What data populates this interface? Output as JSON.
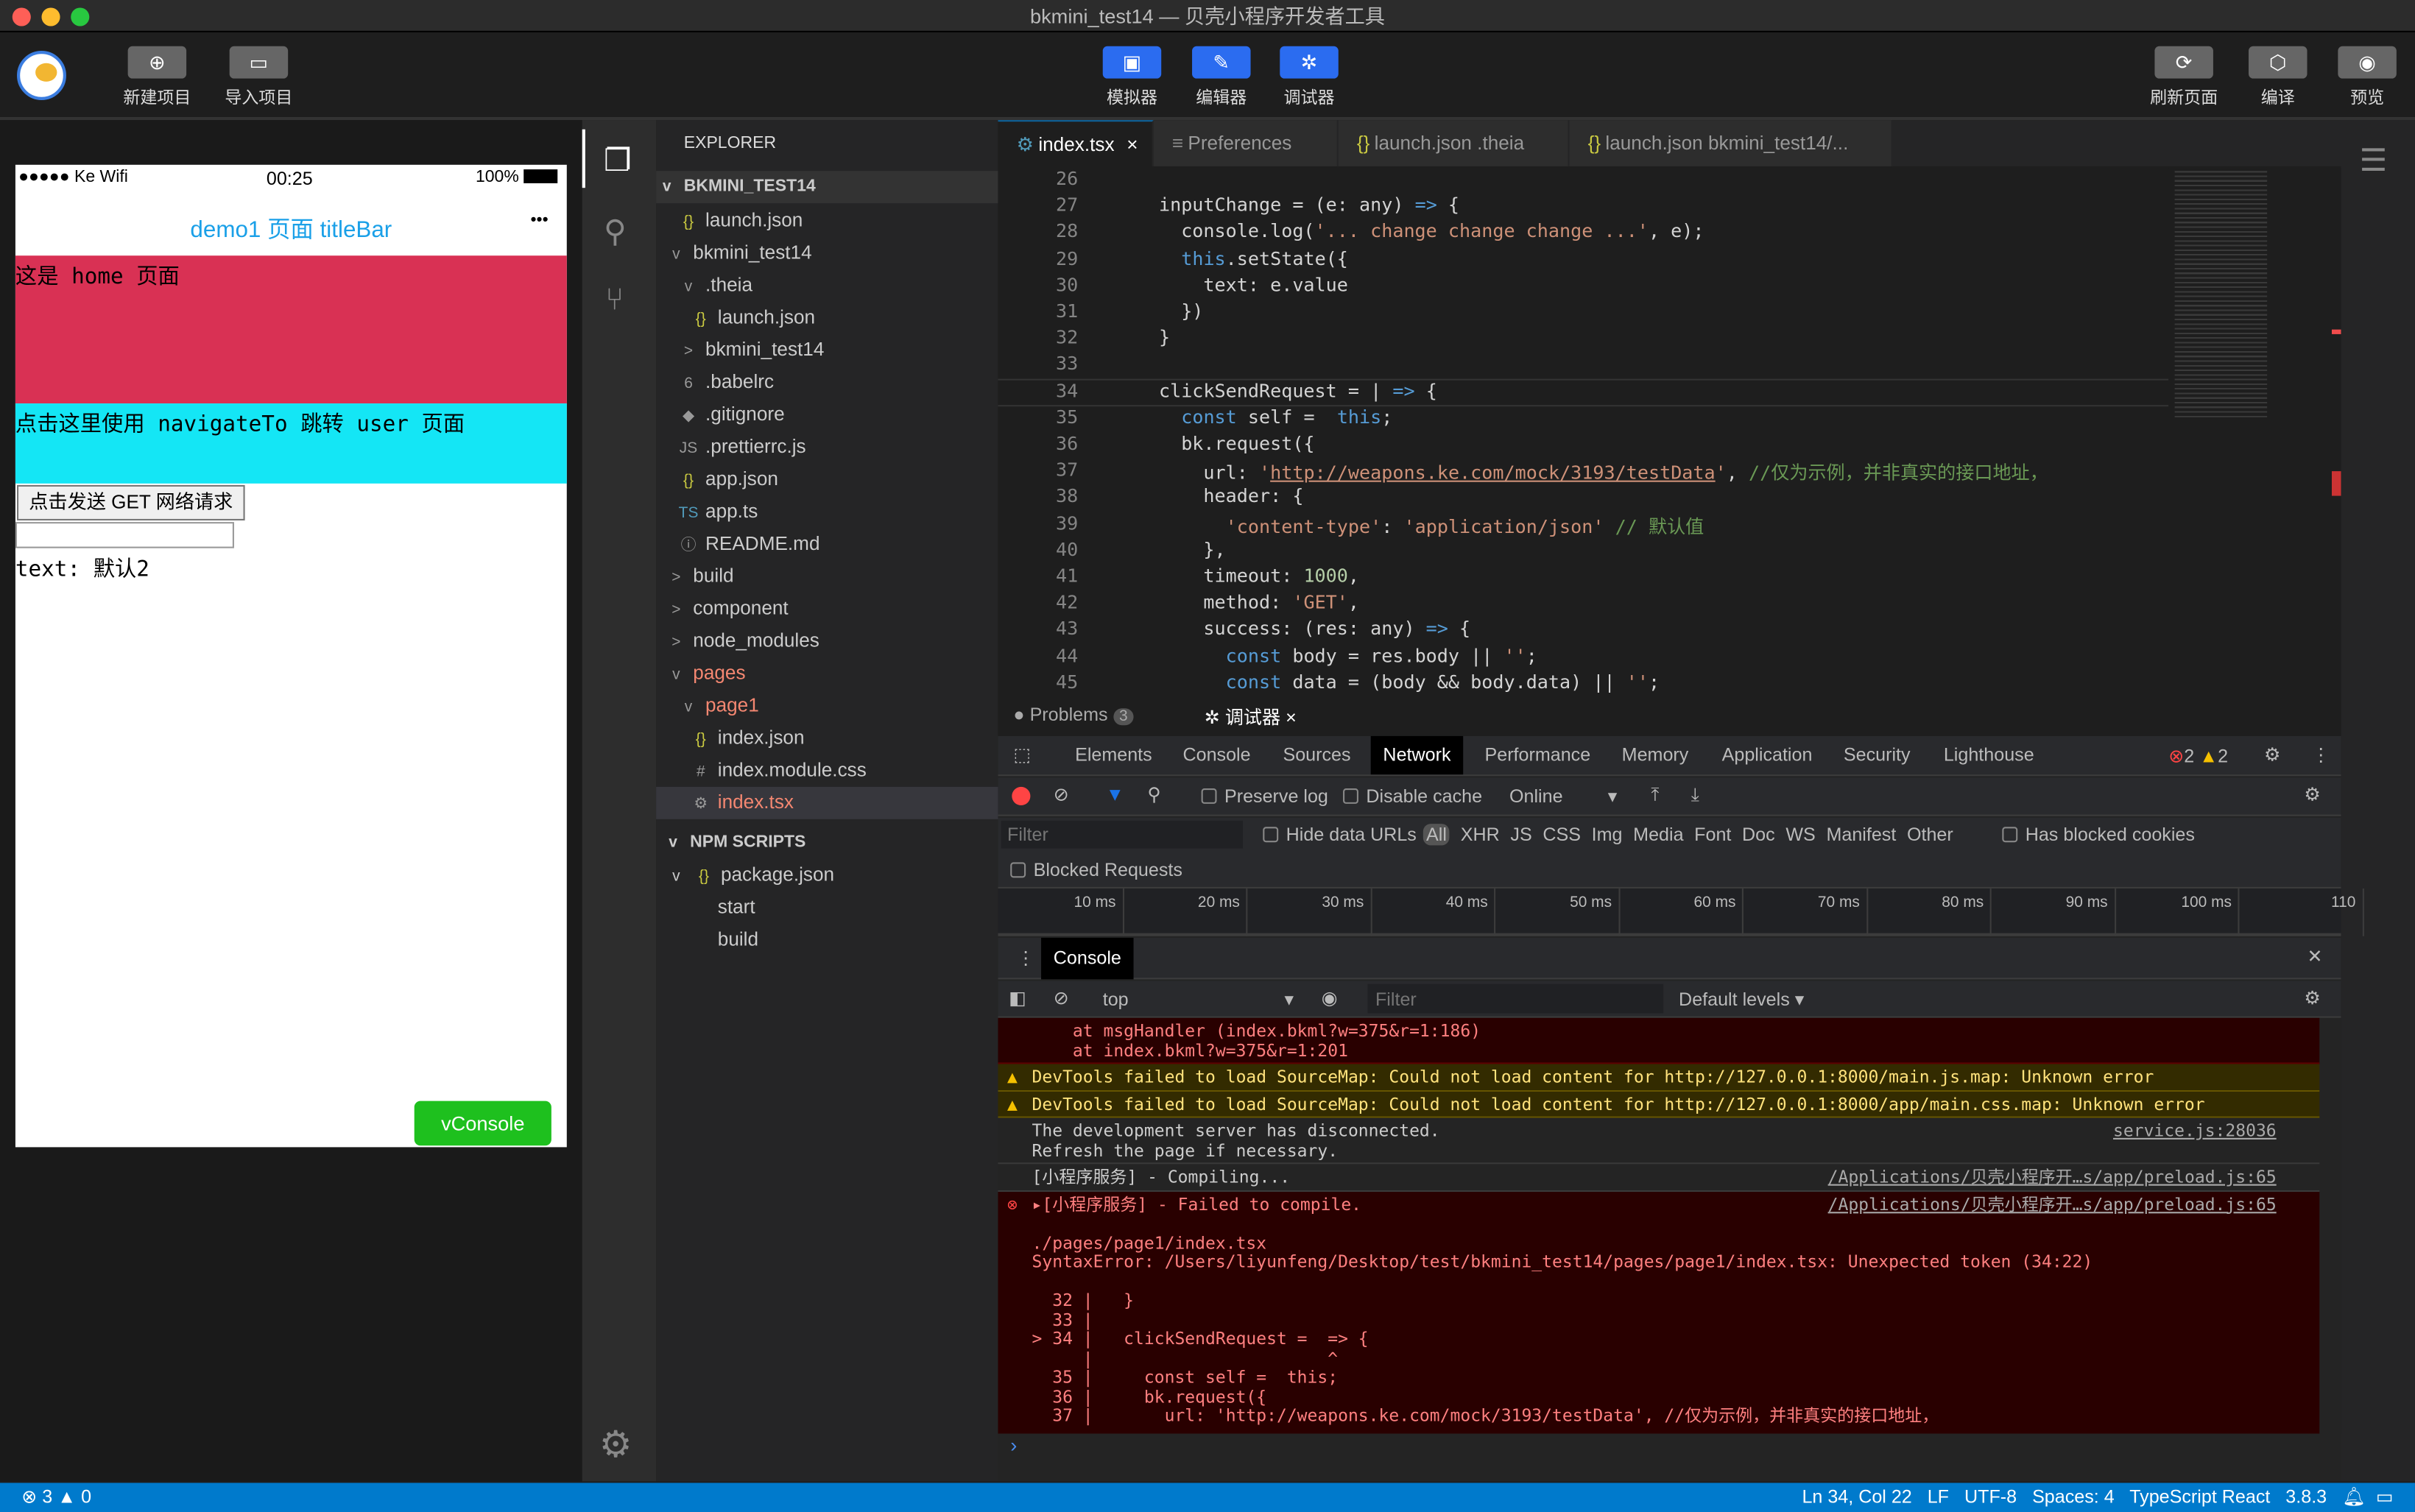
{
  "window": {
    "title": "bkmini_test14 — 贝壳小程序开发者工具"
  },
  "toolbar": {
    "left": [
      {
        "label": "新建项目",
        "icon": "plus-circle-icon"
      },
      {
        "label": "导入项目",
        "icon": "folder-icon"
      }
    ],
    "center": [
      {
        "label": "模拟器",
        "icon": "simulator-icon"
      },
      {
        "label": "编辑器",
        "icon": "editor-icon"
      },
      {
        "label": "调试器",
        "icon": "bug-icon"
      }
    ],
    "right": [
      {
        "label": "刷新页面",
        "icon": "refresh-icon"
      },
      {
        "label": "编译",
        "icon": "cube-icon"
      },
      {
        "label": "预览",
        "icon": "eye-icon"
      }
    ],
    "accent": "#2b6cf0"
  },
  "phone": {
    "carrier": "●●●●● Ke Wifi",
    "time": "00:25",
    "battery": "100%",
    "title": "demo1 页面 titleBar",
    "menu": "•••",
    "home_text": "这是 home 页面",
    "nav_text": "点击这里使用 navigateTo 跳转 user 页面",
    "button": "点击发送 GET 网络请求",
    "input_value": "",
    "text_label": "text: 默认2",
    "vconsole": "vConsole",
    "colors": {
      "home": "#d93154",
      "nav": "#14e6f5",
      "title": "#1aa0e8",
      "vconsole": "#1ec01e"
    }
  },
  "explorer": {
    "title": "EXPLORER",
    "section": "BKMINI_TEST14",
    "items": [
      {
        "label": "launch.json",
        "icon": "{}",
        "depth": 1,
        "color": "#ccc"
      },
      {
        "label": "bkmini_test14",
        "icon": "v",
        "depth": 0,
        "color": "#ccc"
      },
      {
        "label": ".theia",
        "icon": "v",
        "depth": 1,
        "color": "#ccc"
      },
      {
        "label": "launch.json",
        "icon": "{}",
        "depth": 2,
        "color": "#ccc"
      },
      {
        "label": "bkmini_test14",
        "icon": ">",
        "depth": 1,
        "color": "#ccc"
      },
      {
        "label": ".babelrc",
        "icon": "6",
        "depth": 1,
        "color": "#ccc"
      },
      {
        "label": ".gitignore",
        "icon": "◆",
        "depth": 1,
        "color": "#ccc"
      },
      {
        "label": ".prettierrc.js",
        "icon": "JS",
        "depth": 1,
        "color": "#ccc"
      },
      {
        "label": "app.json",
        "icon": "{}",
        "depth": 1,
        "color": "#ccc"
      },
      {
        "label": "app.ts",
        "icon": "TS",
        "depth": 1,
        "color": "#ccc"
      },
      {
        "label": "README.md",
        "icon": "ⓘ",
        "depth": 1,
        "color": "#ccc"
      },
      {
        "label": "build",
        "icon": ">",
        "depth": 0,
        "color": "#ccc"
      },
      {
        "label": "component",
        "icon": ">",
        "depth": 0,
        "color": "#ccc"
      },
      {
        "label": "node_modules",
        "icon": ">",
        "depth": 0,
        "color": "#ccc"
      },
      {
        "label": "pages",
        "icon": "v",
        "depth": 0,
        "color": "#f48771"
      },
      {
        "label": "page1",
        "icon": "v",
        "depth": 1,
        "color": "#f48771"
      },
      {
        "label": "index.json",
        "icon": "{}",
        "depth": 2,
        "color": "#ccc"
      },
      {
        "label": "index.module.css",
        "icon": "#",
        "depth": 2,
        "color": "#ccc"
      },
      {
        "label": "index.tsx",
        "icon": "⚙",
        "depth": 2,
        "color": "#f48771",
        "selected": true
      }
    ],
    "npm_title": "NPM SCRIPTS",
    "npm_items": [
      {
        "label": "package.json",
        "icon": "{}",
        "depth": 0
      },
      {
        "label": "start",
        "depth": 1
      },
      {
        "label": "build",
        "depth": 1
      }
    ]
  },
  "editor": {
    "tabs": [
      {
        "label": "index.tsx",
        "active": true,
        "close": "×"
      },
      {
        "label": "Preferences"
      },
      {
        "label": "launch.json .theia"
      },
      {
        "label": "launch.json bkmini_test14/..."
      }
    ],
    "lines": [
      {
        "n": "26",
        "seg": []
      },
      {
        "n": "27",
        "seg": [
          [
            "  inputChange = (e: any) ",
            ""
          ],
          [
            "=>",
            "kw"
          ],
          [
            " {",
            ""
          ]
        ]
      },
      {
        "n": "28",
        "seg": [
          [
            "    console.log(",
            ""
          ],
          [
            "'... change change change ...'",
            "str"
          ],
          [
            ", e);",
            ""
          ]
        ]
      },
      {
        "n": "29",
        "seg": [
          [
            "    ",
            ""
          ],
          [
            "this",
            "kw"
          ],
          [
            ".setState({",
            ""
          ]
        ]
      },
      {
        "n": "30",
        "seg": [
          [
            "      text: e.value",
            ""
          ]
        ]
      },
      {
        "n": "31",
        "seg": [
          [
            "    })",
            ""
          ]
        ]
      },
      {
        "n": "32",
        "seg": [
          [
            "  }",
            ""
          ]
        ]
      },
      {
        "n": "33",
        "seg": []
      },
      {
        "n": "34",
        "seg": [
          [
            "  clickSendRequest = | ",
            ""
          ],
          [
            "=>",
            "kw"
          ],
          [
            " {",
            ""
          ]
        ]
      },
      {
        "n": "35",
        "seg": [
          [
            "    ",
            ""
          ],
          [
            "const",
            "kw"
          ],
          [
            " self =  ",
            ""
          ],
          [
            "this",
            "kw"
          ],
          [
            ";",
            ""
          ]
        ]
      },
      {
        "n": "36",
        "seg": [
          [
            "    bk.request({",
            ""
          ]
        ]
      },
      {
        "n": "37",
        "seg": [
          [
            "      url: ",
            ""
          ],
          [
            "'",
            "str"
          ],
          [
            "http://weapons.ke.com/mock/3193/testData",
            "url"
          ],
          [
            "'",
            "str"
          ],
          [
            ", ",
            ""
          ],
          [
            "//仅为示例，并非真实的接口地址，",
            "cmt"
          ]
        ]
      },
      {
        "n": "38",
        "seg": [
          [
            "      header: {",
            ""
          ]
        ]
      },
      {
        "n": "39",
        "seg": [
          [
            "        ",
            ""
          ],
          [
            "'content-type'",
            "str"
          ],
          [
            ": ",
            ""
          ],
          [
            "'application/json'",
            "str"
          ],
          [
            " ",
            ""
          ],
          [
            "// 默认值",
            "cmt"
          ]
        ]
      },
      {
        "n": "40",
        "seg": [
          [
            "      },",
            ""
          ]
        ]
      },
      {
        "n": "41",
        "seg": [
          [
            "      timeout: ",
            ""
          ],
          [
            "1000",
            "num"
          ],
          [
            ",",
            ""
          ]
        ]
      },
      {
        "n": "42",
        "seg": [
          [
            "      method: ",
            ""
          ],
          [
            "'GET'",
            "str"
          ],
          [
            ",",
            ""
          ]
        ]
      },
      {
        "n": "43",
        "seg": [
          [
            "      success: (res: any) ",
            ""
          ],
          [
            "=>",
            "kw"
          ],
          [
            " {",
            ""
          ]
        ]
      },
      {
        "n": "44",
        "seg": [
          [
            "        ",
            ""
          ],
          [
            "const",
            "kw"
          ],
          [
            " body = res.body || ",
            ""
          ],
          [
            "''",
            "str"
          ],
          [
            ";",
            ""
          ]
        ]
      },
      {
        "n": "45",
        "seg": [
          [
            "        ",
            ""
          ],
          [
            "const",
            "kw"
          ],
          [
            " data = (body && body.data) || ",
            ""
          ],
          [
            "''",
            "str"
          ],
          [
            ";",
            ""
          ]
        ]
      }
    ]
  },
  "panel": {
    "problems": "Problems",
    "problems_count": "3",
    "debugger": "调试器",
    "close": "×"
  },
  "devtools": {
    "tabs": [
      "Elements",
      "Console",
      "Sources",
      "Network",
      "Performance",
      "Memory",
      "Application",
      "Security",
      "Lighthouse"
    ],
    "active_tab": "Network",
    "errors": "2",
    "warnings": "2",
    "network": {
      "preserve_log": "Preserve log",
      "disable_cache": "Disable cache",
      "throttle": "Online",
      "filter_placeholder": "Filter",
      "hide_data_urls": "Hide data URLs",
      "types": [
        "All",
        "XHR",
        "JS",
        "CSS",
        "Img",
        "Media",
        "Font",
        "Doc",
        "WS",
        "Manifest",
        "Other"
      ],
      "has_blocked_cookies": "Has blocked cookies",
      "blocked_requests": "Blocked Requests",
      "timeline": [
        "10 ms",
        "20 ms",
        "30 ms",
        "40 ms",
        "50 ms",
        "60 ms",
        "70 ms",
        "80 ms",
        "90 ms",
        "100 ms",
        "110"
      ]
    },
    "drawer_tab": "Console",
    "context": "top",
    "console_filter_placeholder": "Filter",
    "levels": "Default levels ▾",
    "messages": [
      {
        "type": "error",
        "text": "    at msgHandler (index.bkml?w=375&r=1:186)\n    at index.bkml?w=375&r=1:201",
        "src": ""
      },
      {
        "type": "warn",
        "text": "DevTools failed to load SourceMap: Could not load content for http://127.0.0.1:8000/main.js.map: Unknown error",
        "src": ""
      },
      {
        "type": "warn",
        "text": "DevTools failed to load SourceMap: Could not load content for http://127.0.0.1:8000/app/main.css.map: Unknown error",
        "src": ""
      },
      {
        "type": "info",
        "text": "The development server has disconnected.\nRefresh the page if necessary.",
        "src": "service.js:28036"
      },
      {
        "type": "info",
        "text": "[小程序服务] - Compiling...",
        "src": "/Applications/贝壳小程序开…s/app/preload.js:65"
      },
      {
        "type": "error",
        "text": "▸[小程序服务] - Failed to compile.\n\n./pages/page1/index.tsx\nSyntaxError: /Users/liyunfeng/Desktop/test/bkmini_test14/pages/page1/index.tsx: Unexpected token (34:22)\n\n  32 |   }\n  33 |\n> 34 |   clickSendRequest =  => {\n     |                       ^\n  35 |     const self =  this;\n  36 |     bk.request({\n  37 |       url: 'http://weapons.ke.com/mock/3193/testData', //仅为示例，并非真实的接口地址，",
        "src": "/Applications/贝壳小程序开…s/app/preload.js:65"
      }
    ],
    "prompt": "›"
  },
  "status": {
    "errors": "3",
    "warnings": "0",
    "position": "Ln 34, Col 22",
    "eol": "LF",
    "encoding": "UTF-8",
    "spaces": "Spaces: 4",
    "language": "TypeScript React",
    "version": "3.8.3"
  }
}
